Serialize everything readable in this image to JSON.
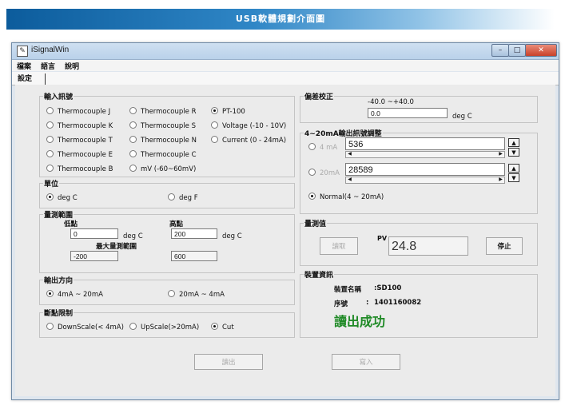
{
  "banner": {
    "title": "USB軟體規劃介面圖"
  },
  "window": {
    "title": "iSignalWin",
    "min": "–",
    "max": "□",
    "close": "✕"
  },
  "menu": [
    "檔案",
    "語言",
    "說明"
  ],
  "tab": {
    "label": "設定"
  },
  "input_signal": {
    "title": "輸入訊號",
    "options": [
      "Thermocouple J",
      "Thermocouple R",
      "PT-100",
      "Thermocouple K",
      "Thermocouple S",
      "Voltage (-10 - 10V)",
      "Thermocouple T",
      "Thermocouple N",
      "Current (0 - 24mA)",
      "Thermocouple E",
      "Thermocouple C",
      "Thermocouple B",
      "mV (-60~60mV)"
    ]
  },
  "unit": {
    "title": "單位",
    "options": [
      "deg C",
      "deg F"
    ]
  },
  "range": {
    "title": "量測範圍",
    "low_label": "低點",
    "high_label": "高點",
    "low_value": "0",
    "high_value": "200",
    "unit_low": "deg C",
    "unit_high": "deg C",
    "max_label": "最大量測範圍",
    "max_low": "-200",
    "max_high": "600"
  },
  "output_dir": {
    "title": "輸出方向",
    "options": [
      "4mA ~ 20mA",
      "20mA ~ 4mA"
    ]
  },
  "break_limit": {
    "title": "斷點限制",
    "options": [
      "DownScale(< 4mA)",
      "UpScale(>20mA)",
      "Cut"
    ]
  },
  "offset": {
    "title": "偏差校正",
    "range": "-40.0  ~+40.0",
    "value": "0.0",
    "unit": "deg C"
  },
  "output_adjust": {
    "title": "4~20mA輸出訊號調整",
    "opt_4ma": "4 mA",
    "val_4ma": "536",
    "opt_20ma": "20mA",
    "val_20ma": "28589",
    "normal": "Normal(4 ~ 20mA)"
  },
  "measure": {
    "title": "量測值",
    "read_btn": "讀取",
    "pv_label": "PV",
    "pv_value": "24.8",
    "stop_btn": "停止"
  },
  "device": {
    "title": "裝置資訊",
    "name_label": "裝置名稱",
    "name_value": ":SD100",
    "serial_label": "序號",
    "serial_sep": ":",
    "serial_value": "1401160082",
    "status": "讀出成功"
  },
  "actions": {
    "read_out": "讀出",
    "write_in": "寫入"
  },
  "colors": {
    "banner_start": "#0c5c9c",
    "success": "#1f8a26",
    "close_btn": "#c9412a"
  }
}
